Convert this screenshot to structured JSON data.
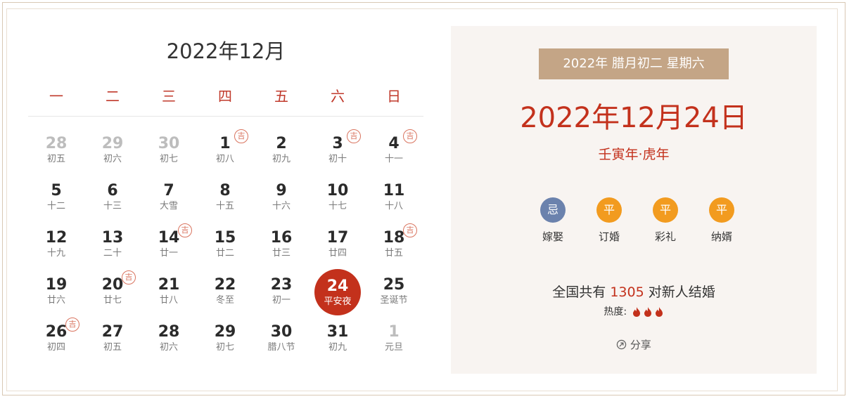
{
  "calendar": {
    "title": "2022年12月",
    "weekdays": [
      "一",
      "二",
      "三",
      "四",
      "五",
      "六",
      "日"
    ],
    "ji_mark": "吉",
    "weeks": [
      [
        {
          "day": "28",
          "lunar": "初五",
          "other": true,
          "ji": false
        },
        {
          "day": "29",
          "lunar": "初六",
          "other": true,
          "ji": false
        },
        {
          "day": "30",
          "lunar": "初七",
          "other": true,
          "ji": false
        },
        {
          "day": "1",
          "lunar": "初八",
          "other": false,
          "ji": true
        },
        {
          "day": "2",
          "lunar": "初九",
          "other": false,
          "ji": false
        },
        {
          "day": "3",
          "lunar": "初十",
          "other": false,
          "ji": true
        },
        {
          "day": "4",
          "lunar": "十一",
          "other": false,
          "ji": true
        }
      ],
      [
        {
          "day": "5",
          "lunar": "十二",
          "other": false,
          "ji": false
        },
        {
          "day": "6",
          "lunar": "十三",
          "other": false,
          "ji": false
        },
        {
          "day": "7",
          "lunar": "大雪",
          "other": false,
          "ji": false
        },
        {
          "day": "8",
          "lunar": "十五",
          "other": false,
          "ji": false
        },
        {
          "day": "9",
          "lunar": "十六",
          "other": false,
          "ji": false
        },
        {
          "day": "10",
          "lunar": "十七",
          "other": false,
          "ji": false
        },
        {
          "day": "11",
          "lunar": "十八",
          "other": false,
          "ji": false
        }
      ],
      [
        {
          "day": "12",
          "lunar": "十九",
          "other": false,
          "ji": false
        },
        {
          "day": "13",
          "lunar": "二十",
          "other": false,
          "ji": false
        },
        {
          "day": "14",
          "lunar": "廿一",
          "other": false,
          "ji": true
        },
        {
          "day": "15",
          "lunar": "廿二",
          "other": false,
          "ji": false
        },
        {
          "day": "16",
          "lunar": "廿三",
          "other": false,
          "ji": false
        },
        {
          "day": "17",
          "lunar": "廿四",
          "other": false,
          "ji": false
        },
        {
          "day": "18",
          "lunar": "廿五",
          "other": false,
          "ji": true
        }
      ],
      [
        {
          "day": "19",
          "lunar": "廿六",
          "other": false,
          "ji": false
        },
        {
          "day": "20",
          "lunar": "廿七",
          "other": false,
          "ji": true
        },
        {
          "day": "21",
          "lunar": "廿八",
          "other": false,
          "ji": false
        },
        {
          "day": "22",
          "lunar": "冬至",
          "other": false,
          "ji": false
        },
        {
          "day": "23",
          "lunar": "初一",
          "other": false,
          "ji": false
        },
        {
          "day": "24",
          "lunar": "平安夜",
          "other": false,
          "ji": false,
          "selected": true
        },
        {
          "day": "25",
          "lunar": "圣诞节",
          "other": false,
          "ji": false
        }
      ],
      [
        {
          "day": "26",
          "lunar": "初四",
          "other": false,
          "ji": true
        },
        {
          "day": "27",
          "lunar": "初五",
          "other": false,
          "ji": false
        },
        {
          "day": "28",
          "lunar": "初六",
          "other": false,
          "ji": false
        },
        {
          "day": "29",
          "lunar": "初七",
          "other": false,
          "ji": false
        },
        {
          "day": "30",
          "lunar": "腊八节",
          "other": false,
          "ji": false
        },
        {
          "day": "31",
          "lunar": "初九",
          "other": false,
          "ji": false
        },
        {
          "day": "1",
          "lunar": "元旦",
          "other": true,
          "ji": false
        }
      ]
    ]
  },
  "detail": {
    "badge": "2022年  腊月初二  星期六",
    "date": "2022年12月24日",
    "ganzhi": "壬寅年·虎年",
    "items": [
      {
        "mark": "忌",
        "label": "嫁娶",
        "color": "#6b82ad"
      },
      {
        "mark": "平",
        "label": "订婚",
        "color": "#f29b1f"
      },
      {
        "mark": "平",
        "label": "彩礼",
        "color": "#f29b1f"
      },
      {
        "mark": "平",
        "label": "纳婿",
        "color": "#f29b1f"
      }
    ],
    "stat_prefix": "全国共有",
    "stat_count": "1305",
    "stat_suffix": "对新人结婚",
    "heat_label": "热度:",
    "heat_level": 3,
    "heat_icon": "flame-icon",
    "flame_color": "#c3311c",
    "share_label": "分享",
    "share_icon": "share-icon"
  }
}
